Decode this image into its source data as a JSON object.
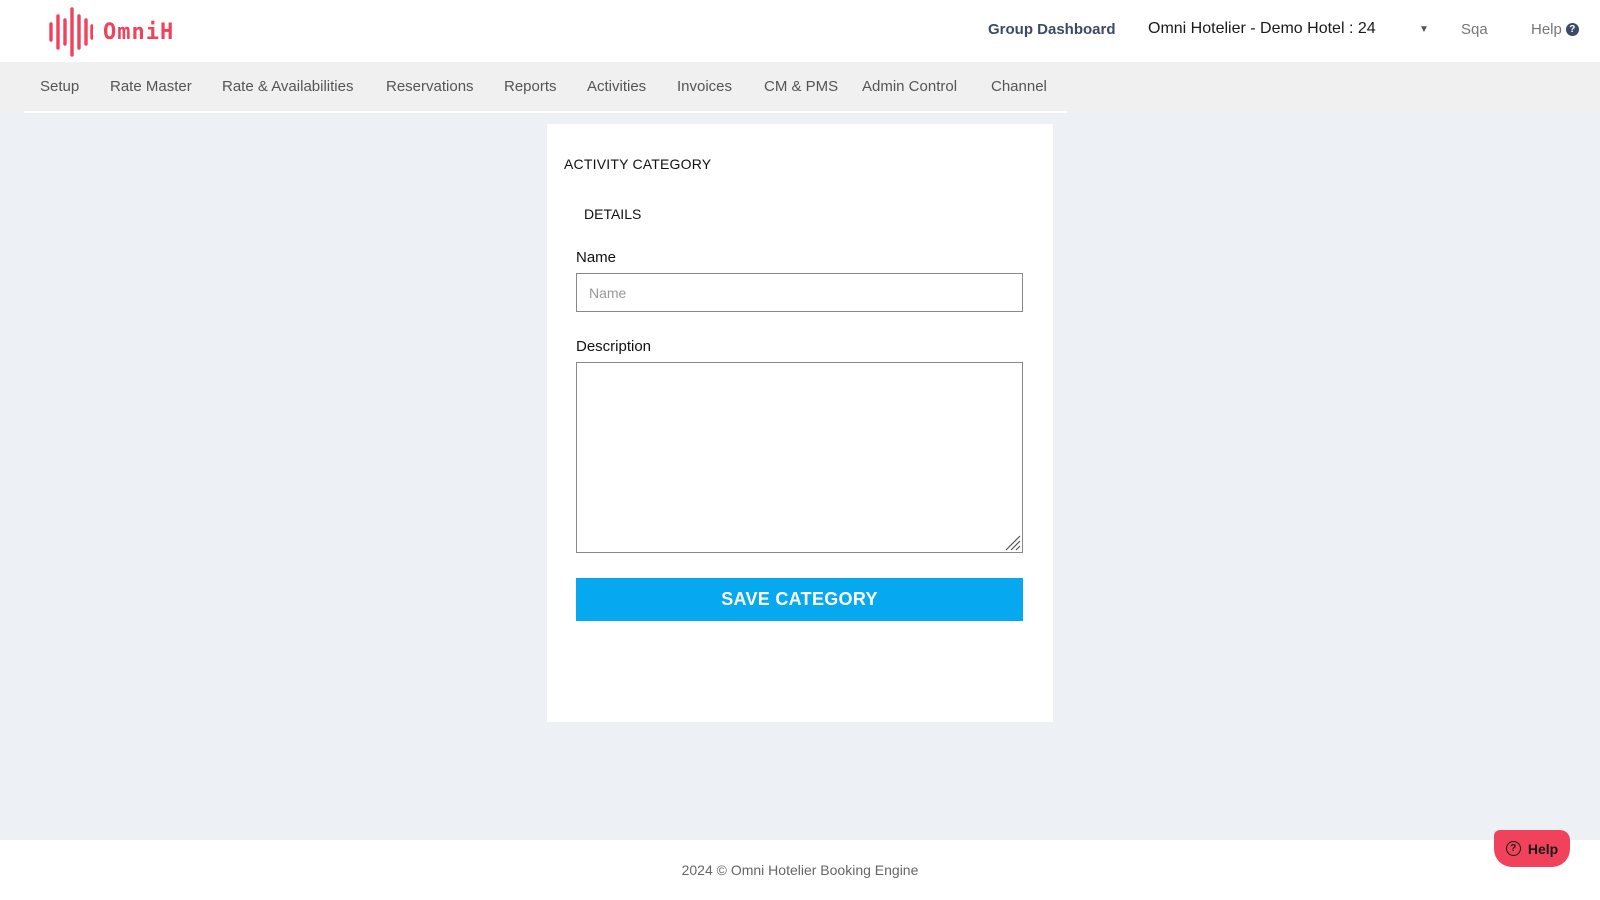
{
  "header": {
    "logo_text": "OmniH",
    "group_dashboard": "Group Dashboard",
    "hotel_selector": "Omni Hotelier - Demo Hotel : 24",
    "user": "Sqa",
    "help": "Help"
  },
  "nav": {
    "items": [
      {
        "label": "Setup"
      },
      {
        "label": "Rate Master"
      },
      {
        "label": "Rate & Availabilities"
      },
      {
        "label": "Reservations"
      },
      {
        "label": "Reports"
      },
      {
        "label": "Activities"
      },
      {
        "label": "Invoices"
      },
      {
        "label": "CM & PMS"
      },
      {
        "label": "Admin Control"
      },
      {
        "label": "Channel"
      }
    ]
  },
  "form": {
    "title": "ACTIVITY CATEGORY",
    "section": "DETAILS",
    "name_label": "Name",
    "name_placeholder": "Name",
    "name_value": "",
    "description_label": "Description",
    "description_value": "",
    "save_button": "SAVE CATEGORY"
  },
  "footer": {
    "copyright": "2024 © Omni Hotelier Booking Engine"
  },
  "help_widget": {
    "label": "Help"
  },
  "colors": {
    "brand": "#f0435b",
    "primary_button": "#06a8f0",
    "page_background": "#edf0f4",
    "nav_background": "#f0f0f0"
  }
}
